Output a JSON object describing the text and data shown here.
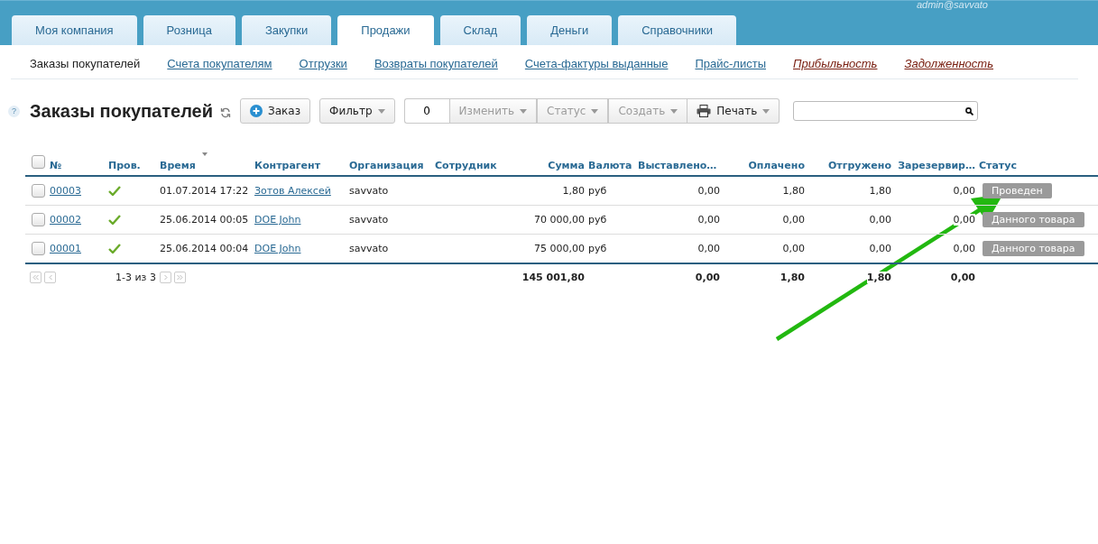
{
  "user": "admin@savvato",
  "tabs": [
    {
      "label": "Моя компания",
      "selected": false
    },
    {
      "label": "Розница",
      "selected": false
    },
    {
      "label": "Закупки",
      "selected": false
    },
    {
      "label": "Продажи",
      "selected": true
    },
    {
      "label": "Склад",
      "selected": false
    },
    {
      "label": "Деньги",
      "selected": false
    },
    {
      "label": "Справочники",
      "selected": false
    }
  ],
  "subnav": [
    {
      "label": "Заказы покупателей",
      "kind": "link",
      "selected": true
    },
    {
      "label": "Счета покупателям",
      "kind": "link",
      "selected": false
    },
    {
      "label": "Отгрузки",
      "kind": "link",
      "selected": false
    },
    {
      "label": "Возвраты покупателей",
      "kind": "link",
      "selected": false
    },
    {
      "label": "Счета-фактуры выданные",
      "kind": "link",
      "selected": false
    },
    {
      "label": "Прайс-листы",
      "kind": "link",
      "selected": false
    },
    {
      "label": "Прибыльность",
      "kind": "report",
      "selected": false
    },
    {
      "label": "Задолженность",
      "kind": "report",
      "selected": false
    }
  ],
  "help": "?",
  "title": "Заказы покупателей",
  "toolbar": {
    "add": "Заказ",
    "filter": "Фильтр",
    "count": "0",
    "actions": [
      {
        "label": "Изменить",
        "disabled": true
      },
      {
        "label": "Статус",
        "disabled": true
      },
      {
        "label": "Создать",
        "disabled": true
      }
    ],
    "print": "Печать"
  },
  "table": {
    "select_all": {
      "checked": false
    },
    "columns": [
      {
        "label": "№",
        "numeric": false,
        "sorted": false
      },
      {
        "label": "Пров.",
        "numeric": false,
        "sorted": false
      },
      {
        "label": "Время",
        "numeric": false,
        "sorted": true
      },
      {
        "label": "Контрагент",
        "numeric": false,
        "sorted": false
      },
      {
        "label": "Организация",
        "numeric": false,
        "sorted": false
      },
      {
        "label": "Сотрудник",
        "numeric": false,
        "sorted": false
      },
      {
        "label": "Сумма",
        "numeric": true,
        "sorted": false
      },
      {
        "label": "Валюта",
        "numeric": false,
        "sorted": false
      },
      {
        "label": "Выставлено…",
        "numeric": false,
        "sorted": false
      },
      {
        "label": "Оплачено",
        "numeric": true,
        "sorted": false
      },
      {
        "label": "Отгружено",
        "numeric": true,
        "sorted": false
      },
      {
        "label": "Зарезервир…",
        "numeric": true,
        "sorted": false
      },
      {
        "label": "Статус",
        "numeric": false,
        "sorted": false
      }
    ],
    "rows": [
      {
        "checked": false,
        "number": "00003",
        "conducted": true,
        "time": "01.07.2014 17:22",
        "counterparty": "Зотов Алексей",
        "organization": "savvato",
        "sum": "1,80",
        "currency": "руб",
        "invoiced": "0,00",
        "paid": "1,80",
        "shipped": "1,80",
        "reserved": "0,00",
        "status": "Проведен"
      },
      {
        "checked": false,
        "number": "00002",
        "conducted": true,
        "time": "25.06.2014 00:05",
        "counterparty": "DOE John",
        "organization": "savvato",
        "sum": "70 000,00",
        "currency": "руб",
        "invoiced": "0,00",
        "paid": "0,00",
        "shipped": "0,00",
        "reserved": "0,00",
        "status": "Данного товара"
      },
      {
        "checked": false,
        "number": "00001",
        "conducted": true,
        "time": "25.06.2014 00:04",
        "counterparty": "DOE John",
        "organization": "savvato",
        "sum": "75 000,00",
        "currency": "руб",
        "invoiced": "0,00",
        "paid": "0,00",
        "shipped": "0,00",
        "reserved": "0,00",
        "status": "Данного товара"
      }
    ],
    "footer": {
      "range": "1-3 из 3",
      "sum": "145 001,80",
      "invoiced": "0,00",
      "paid": "1,80",
      "shipped": "1,80",
      "reserved": "0,00"
    }
  }
}
